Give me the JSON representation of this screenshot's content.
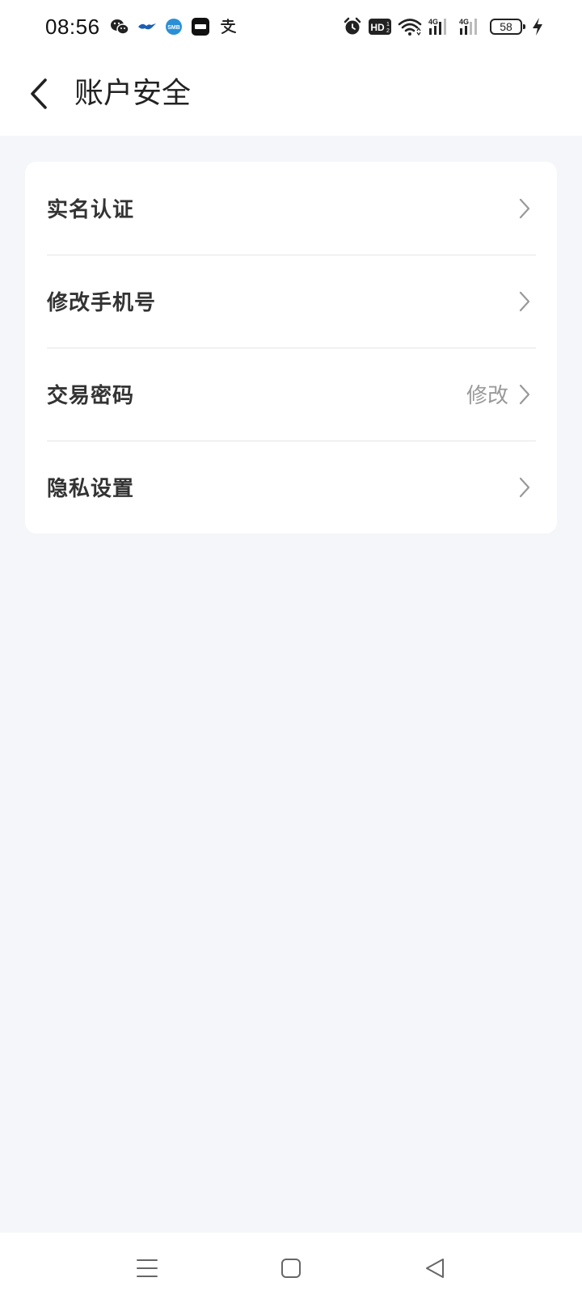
{
  "status_bar": {
    "time": "08:56",
    "battery": "58",
    "network_label_1": "4G",
    "network_label_2": "4G",
    "hd_label": "HD"
  },
  "header": {
    "title": "账户安全"
  },
  "settings": {
    "items": [
      {
        "label": "实名认证",
        "value": ""
      },
      {
        "label": "修改手机号",
        "value": ""
      },
      {
        "label": "交易密码",
        "value": "修改"
      },
      {
        "label": "隐私设置",
        "value": ""
      }
    ]
  },
  "colors": {
    "background": "#f4f6f9",
    "card": "#ffffff",
    "label": "#333333",
    "secondary": "#999999"
  }
}
